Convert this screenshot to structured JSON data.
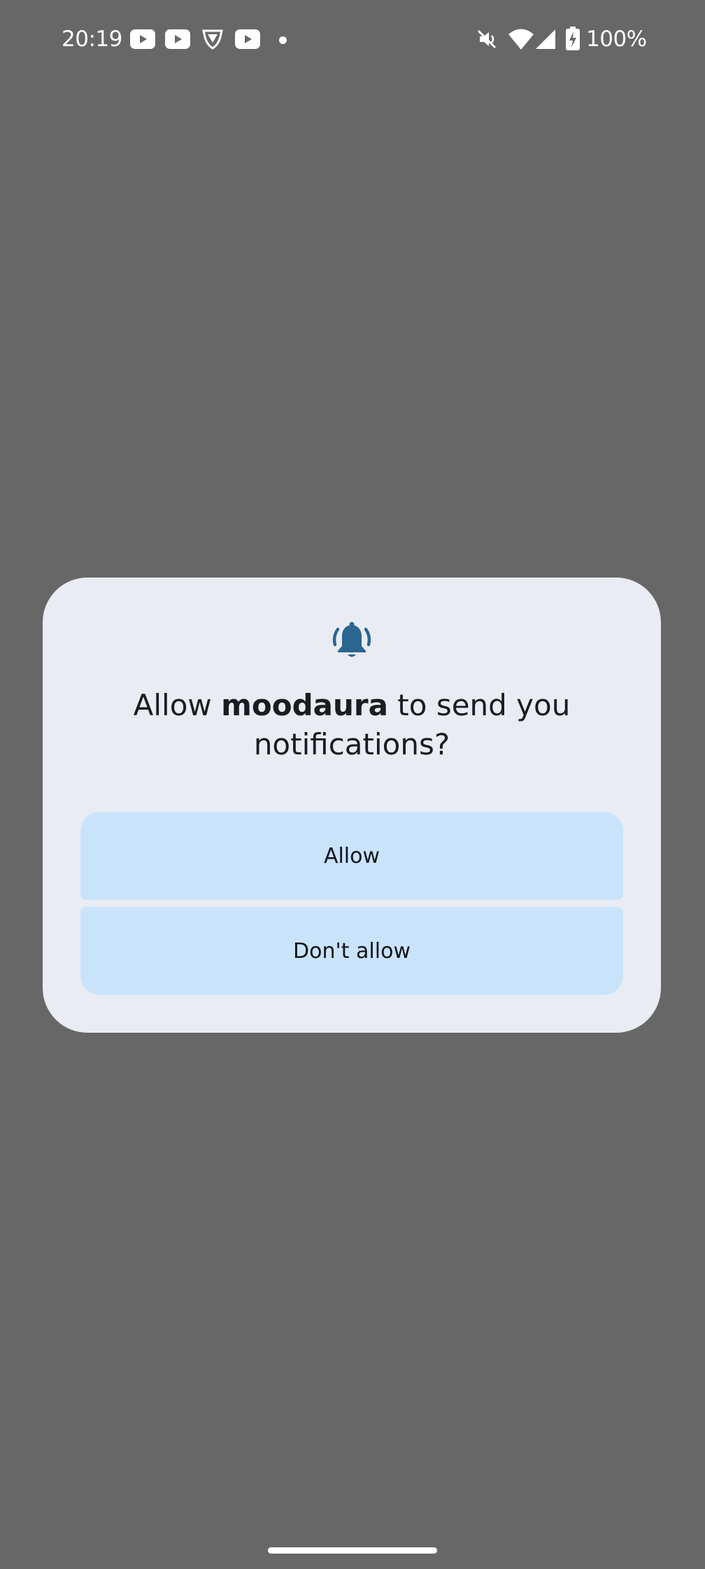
{
  "status_bar": {
    "time": "20:19",
    "notification_icons": [
      "youtube-icon",
      "youtube-icon",
      "shield-app-icon",
      "youtube-icon",
      "more-dot-icon"
    ],
    "system_icons": [
      "mute-icon",
      "wifi-icon",
      "cell-signal-icon",
      "battery-charging-icon"
    ],
    "battery_percent": "100%"
  },
  "dialog": {
    "icon": "bell-ringing-icon",
    "title_prefix": "Allow ",
    "app_name": "moodaura",
    "title_suffix": " to send you notifications?",
    "allow_label": "Allow",
    "deny_label": "Don't allow"
  },
  "colors": {
    "scrim": "#676767",
    "dialog_bg": "#e9ecf2",
    "button_bg": "#c9e3fb",
    "icon_accent": "#2b6690"
  }
}
